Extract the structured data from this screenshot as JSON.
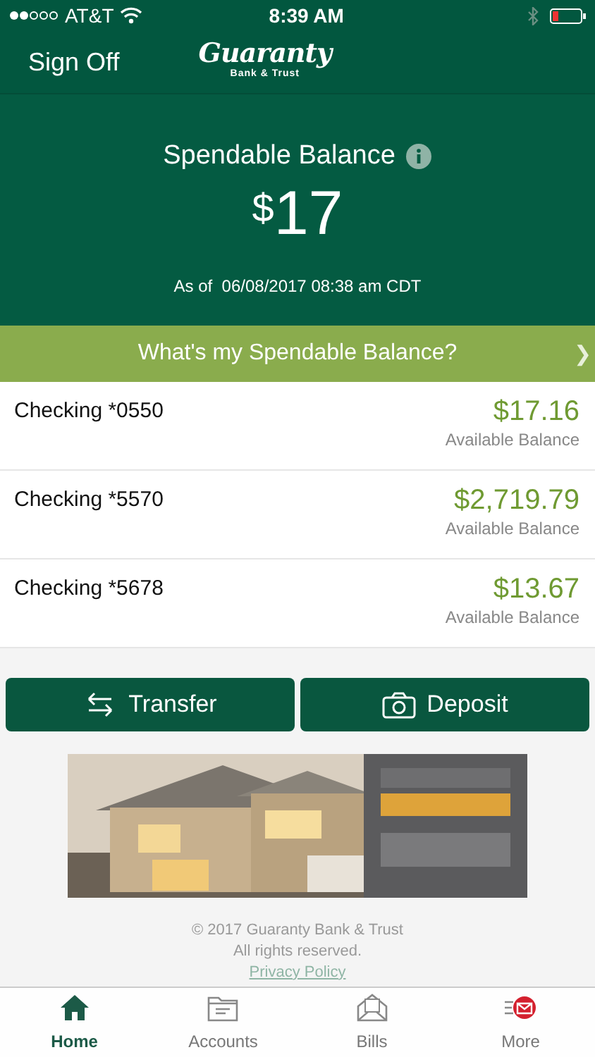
{
  "status_bar": {
    "carrier": "AT&T",
    "time": "8:39 AM"
  },
  "header": {
    "left_button": "Sign Off",
    "logo": {
      "name": "Guaranty",
      "subtitle": "Bank & Trust"
    }
  },
  "balance": {
    "title": "Spendable Balance",
    "currency": "$",
    "amount": "17",
    "as_of_label": "As of",
    "timestamp": "06/08/2017 08:38 am CDT"
  },
  "info_link": {
    "label": "What's my Spendable Balance?",
    "chevron": "❯"
  },
  "accounts": [
    {
      "name": "Checking *0550",
      "balance": "$17.16",
      "balance_label": "Available Balance"
    },
    {
      "name": "Checking *5570",
      "balance": "$2,719.79",
      "balance_label": "Available Balance"
    },
    {
      "name": "Checking *5678",
      "balance": "$13.67",
      "balance_label": "Available Balance"
    }
  ],
  "actions": [
    {
      "kind": "transfer",
      "label": "Transfer"
    },
    {
      "kind": "camera",
      "label": "Deposit"
    }
  ],
  "footer": {
    "copyright": "© 2017 Guaranty Bank & Trust",
    "rights": "All rights reserved.",
    "privacy_link": "Privacy Policy"
  },
  "tabs": [
    {
      "kind": "home",
      "label": "Home",
      "selected": true
    },
    {
      "kind": "accounts",
      "label": "Accounts",
      "selected": false
    },
    {
      "kind": "bills",
      "label": "Bills",
      "selected": false
    },
    {
      "kind": "more",
      "label": "More",
      "selected": false
    }
  ]
}
